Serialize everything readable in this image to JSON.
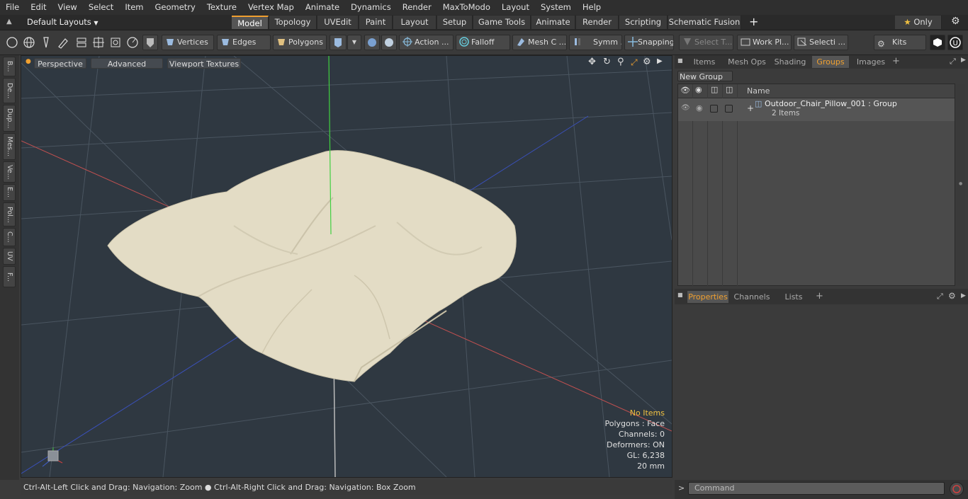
{
  "menu": [
    "File",
    "Edit",
    "View",
    "Select",
    "Item",
    "Geometry",
    "Texture",
    "Vertex Map",
    "Animate",
    "Dynamics",
    "Render",
    "MaxToModo",
    "Layout",
    "System",
    "Help"
  ],
  "layout_selector": "Default Layouts",
  "mode_tabs": [
    "Model",
    "Topology",
    "UVEdit",
    "Paint",
    "Layout",
    "Setup",
    "Game Tools",
    "Animate",
    "Render",
    "Scripting",
    "Schematic Fusion"
  ],
  "active_mode_tab": "Model",
  "only_label": "Only",
  "toolbar": {
    "vertices": "Vertices",
    "edges": "Edges",
    "polygons": "Polygons",
    "action": "Action ...",
    "falloff": "Falloff",
    "mesh_c": "Mesh C ...",
    "symm": "Symm ...",
    "snapping": "Snapping",
    "select_t": "Select T...",
    "work_pl": "Work Pl...",
    "selecti": "Selecti ...",
    "kits": "Kits"
  },
  "left_tabs": [
    "B...",
    "De...",
    "Dup...",
    "Mes...",
    "Ve...",
    "E...",
    "Pol...",
    "C...",
    "UV",
    "F..."
  ],
  "viewport": {
    "perspective": "Perspective",
    "advanced": "Advanced",
    "viewport_textures": "Viewport Textures",
    "info": {
      "no_items": "No Items",
      "polygons": "Polygons : Face",
      "channels": "Channels: 0",
      "deformers": "Deformers: ON",
      "gl": "GL: 6,238",
      "units": "20 mm"
    }
  },
  "status_text": "Ctrl-Alt-Left Click and Drag: Navigation: Zoom ● Ctrl-Alt-Right Click and Drag: Navigation: Box Zoom",
  "right_tabs": [
    "Items",
    "Mesh Ops",
    "Shading",
    "Groups",
    "Images"
  ],
  "active_right_tab": "Groups",
  "new_group": "New Group",
  "group_header_name": "Name",
  "group_item": {
    "name": "Outdoor_Chair_Pillow_001 : Group",
    "count": "2 Items"
  },
  "prop_tabs": [
    "Properties",
    "Channels",
    "Lists"
  ],
  "active_prop_tab": "Properties",
  "command_placeholder": "Command",
  "colors": {
    "accent": "#f0a030",
    "viewport_bg": "#2f3841",
    "pillow": "#e3dcc5"
  }
}
